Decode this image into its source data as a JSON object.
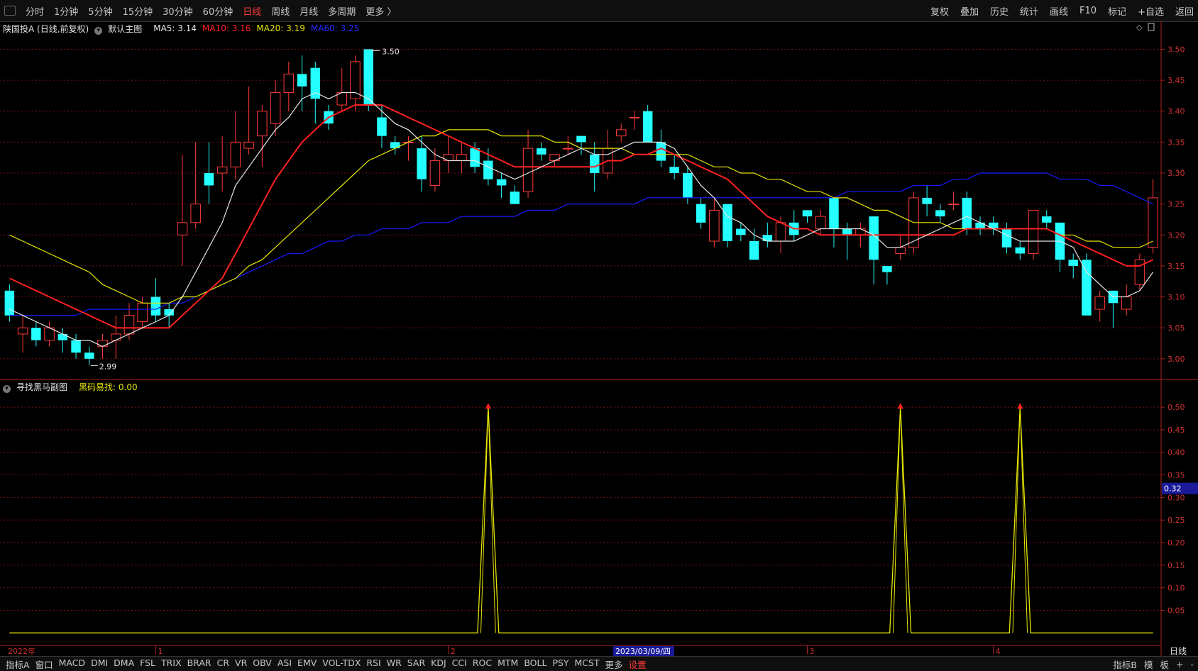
{
  "topbar": {
    "periods": [
      "分时",
      "1分钟",
      "5分钟",
      "15分钟",
      "30分钟",
      "60分钟",
      "日线",
      "周线",
      "月线",
      "多周期",
      "更多 〉"
    ],
    "active_period": "日线",
    "right_buttons": [
      "复权",
      "叠加",
      "历史",
      "统计",
      "画线",
      "F10",
      "标记",
      "+自选",
      "返回"
    ]
  },
  "main_legend": {
    "stock": "陕国投A (日线,前复权)",
    "template": "默认主图",
    "ma5": "MA5: 3.14",
    "ma10": "MA10: 3.16",
    "ma20": "MA20: 3.19",
    "ma60": "MA60: 3.25"
  },
  "sub_legend": {
    "name": "寻找黑马副图",
    "indicator": "黑码易找: 0.00"
  },
  "colors": {
    "up": "#ff3a3a",
    "down": "#24ffff",
    "ma5": "#e6e6e6",
    "ma10": "#ff2020",
    "ma20": "#e6e600",
    "ma60": "#1a1aff",
    "grid": "#7a1010",
    "axis": "#b02020"
  },
  "bottombar": {
    "items": [
      "指标A",
      "窗口",
      "MACD",
      "DMI",
      "DMA",
      "FSL",
      "TRIX",
      "BRAR",
      "CR",
      "VR",
      "OBV",
      "ASI",
      "EMV",
      "VOL-TDX",
      "RSI",
      "WR",
      "SAR",
      "KDJ",
      "CCI",
      "ROC",
      "MTM",
      "BOLL",
      "PSY",
      "MCST",
      "更多",
      "设置"
    ],
    "right_items": [
      "指标B",
      "模",
      "板",
      "+",
      "-"
    ]
  },
  "chart_data": [
    {
      "type": "candlestick",
      "title": "",
      "ylim": [
        2.97,
        3.52
      ],
      "yticks": [
        "3.50",
        "3.45",
        "3.40",
        "3.35",
        "3.30",
        "3.25",
        "3.20",
        "3.15",
        "3.10",
        "3.05",
        "3.00"
      ],
      "annotations": {
        "high": "3.50",
        "low": "2.99"
      },
      "x_labels": [
        "2022年",
        "1",
        "2",
        "3",
        "4"
      ],
      "crosshair_date": "2023/03/09/四",
      "period_label": "日线",
      "candles": [
        [
          3.11,
          3.07,
          3.12,
          3.06
        ],
        [
          3.04,
          3.05,
          3.07,
          3.01
        ],
        [
          3.05,
          3.03,
          3.06,
          3.02
        ],
        [
          3.03,
          3.05,
          3.06,
          3.02
        ],
        [
          3.04,
          3.03,
          3.05,
          3.01
        ],
        [
          3.03,
          3.01,
          3.04,
          3.0
        ],
        [
          3.01,
          3.0,
          3.02,
          2.99
        ],
        [
          3.02,
          3.03,
          3.04,
          3.0
        ],
        [
          3.03,
          3.04,
          3.07,
          3.0
        ],
        [
          3.04,
          3.07,
          3.09,
          3.03
        ],
        [
          3.06,
          3.09,
          3.1,
          3.05
        ],
        [
          3.1,
          3.07,
          3.13,
          3.06
        ],
        [
          3.08,
          3.07,
          3.09,
          3.05
        ],
        [
          3.2,
          3.22,
          3.33,
          3.15
        ],
        [
          3.22,
          3.25,
          3.35,
          3.21
        ],
        [
          3.3,
          3.28,
          3.35,
          3.25
        ],
        [
          3.3,
          3.31,
          3.36,
          3.27
        ],
        [
          3.31,
          3.35,
          3.4,
          3.29
        ],
        [
          3.34,
          3.35,
          3.44,
          3.33
        ],
        [
          3.36,
          3.4,
          3.41,
          3.31
        ],
        [
          3.38,
          3.43,
          3.45,
          3.36
        ],
        [
          3.43,
          3.46,
          3.48,
          3.4
        ],
        [
          3.46,
          3.44,
          3.49,
          3.4
        ],
        [
          3.47,
          3.42,
          3.48,
          3.38
        ],
        [
          3.4,
          3.38,
          3.41,
          3.37
        ],
        [
          3.41,
          3.43,
          3.47,
          3.4
        ],
        [
          3.42,
          3.48,
          3.49,
          3.4
        ],
        [
          3.5,
          3.41,
          3.5,
          3.4
        ],
        [
          3.39,
          3.36,
          3.41,
          3.34
        ],
        [
          3.35,
          3.34,
          3.36,
          3.33
        ],
        [
          3.35,
          3.35,
          3.36,
          3.32
        ],
        [
          3.34,
          3.29,
          3.36,
          3.27
        ],
        [
          3.28,
          3.32,
          3.34,
          3.27
        ],
        [
          3.32,
          3.33,
          3.36,
          3.3
        ],
        [
          3.32,
          3.33,
          3.35,
          3.3
        ],
        [
          3.34,
          3.31,
          3.35,
          3.3
        ],
        [
          3.32,
          3.29,
          3.34,
          3.28
        ],
        [
          3.29,
          3.28,
          3.3,
          3.26
        ],
        [
          3.27,
          3.25,
          3.28,
          3.25
        ],
        [
          3.27,
          3.34,
          3.37,
          3.26
        ],
        [
          3.34,
          3.33,
          3.35,
          3.32
        ],
        [
          3.32,
          3.33,
          3.33,
          3.31
        ],
        [
          3.34,
          3.34,
          3.36,
          3.33
        ],
        [
          3.36,
          3.35,
          3.36,
          3.33
        ],
        [
          3.33,
          3.3,
          3.35,
          3.27
        ],
        [
          3.3,
          3.34,
          3.37,
          3.29
        ],
        [
          3.36,
          3.37,
          3.38,
          3.35
        ],
        [
          3.39,
          3.39,
          3.4,
          3.37
        ],
        [
          3.4,
          3.35,
          3.41,
          3.35
        ],
        [
          3.35,
          3.32,
          3.37,
          3.31
        ],
        [
          3.31,
          3.3,
          3.33,
          3.29
        ],
        [
          3.3,
          3.26,
          3.31,
          3.25
        ],
        [
          3.25,
          3.22,
          3.26,
          3.21
        ],
        [
          3.19,
          3.24,
          3.26,
          3.18
        ],
        [
          3.25,
          3.19,
          3.25,
          3.18
        ],
        [
          3.21,
          3.2,
          3.22,
          3.19
        ],
        [
          3.19,
          3.16,
          3.21,
          3.16
        ],
        [
          3.2,
          3.19,
          3.22,
          3.18
        ],
        [
          3.19,
          3.22,
          3.23,
          3.17
        ],
        [
          3.22,
          3.2,
          3.24,
          3.19
        ],
        [
          3.24,
          3.23,
          3.24,
          3.22
        ],
        [
          3.21,
          3.23,
          3.24,
          3.2
        ],
        [
          3.26,
          3.21,
          3.26,
          3.18
        ],
        [
          3.21,
          3.2,
          3.22,
          3.16
        ],
        [
          3.2,
          3.21,
          3.22,
          3.18
        ],
        [
          3.23,
          3.16,
          3.23,
          3.12
        ],
        [
          3.15,
          3.14,
          3.15,
          3.12
        ],
        [
          3.17,
          3.18,
          3.2,
          3.16
        ],
        [
          3.18,
          3.26,
          3.27,
          3.17
        ],
        [
          3.26,
          3.25,
          3.28,
          3.23
        ],
        [
          3.24,
          3.23,
          3.25,
          3.22
        ],
        [
          3.25,
          3.25,
          3.27,
          3.24
        ],
        [
          3.26,
          3.21,
          3.27,
          3.2
        ],
        [
          3.22,
          3.21,
          3.23,
          3.2
        ],
        [
          3.22,
          3.21,
          3.23,
          3.2
        ],
        [
          3.21,
          3.18,
          3.22,
          3.17
        ],
        [
          3.18,
          3.17,
          3.19,
          3.16
        ],
        [
          3.17,
          3.24,
          3.24,
          3.16
        ],
        [
          3.23,
          3.22,
          3.24,
          3.21
        ],
        [
          3.22,
          3.16,
          3.22,
          3.14
        ],
        [
          3.16,
          3.15,
          3.17,
          3.13
        ],
        [
          3.16,
          3.07,
          3.17,
          3.07
        ],
        [
          3.08,
          3.1,
          3.11,
          3.06
        ],
        [
          3.11,
          3.09,
          3.11,
          3.05
        ],
        [
          3.08,
          3.1,
          3.12,
          3.07
        ],
        [
          3.12,
          3.16,
          3.17,
          3.11
        ],
        [
          3.18,
          3.26,
          3.29,
          3.17
        ]
      ],
      "ma5": [
        3.08,
        3.07,
        3.06,
        3.05,
        3.04,
        3.03,
        3.03,
        3.02,
        3.03,
        3.04,
        3.05,
        3.06,
        3.07,
        3.1,
        3.14,
        3.18,
        3.22,
        3.28,
        3.31,
        3.34,
        3.37,
        3.39,
        3.42,
        3.43,
        3.42,
        3.43,
        3.43,
        3.42,
        3.4,
        3.38,
        3.37,
        3.35,
        3.33,
        3.32,
        3.32,
        3.32,
        3.31,
        3.3,
        3.29,
        3.3,
        3.31,
        3.32,
        3.33,
        3.34,
        3.33,
        3.33,
        3.34,
        3.35,
        3.35,
        3.35,
        3.34,
        3.31,
        3.28,
        3.26,
        3.23,
        3.22,
        3.2,
        3.19,
        3.19,
        3.19,
        3.2,
        3.21,
        3.21,
        3.21,
        3.21,
        3.2,
        3.18,
        3.18,
        3.19,
        3.2,
        3.21,
        3.22,
        3.23,
        3.22,
        3.21,
        3.2,
        3.19,
        3.19,
        3.19,
        3.19,
        3.18,
        3.14,
        3.12,
        3.1,
        3.1,
        3.11,
        3.14
      ],
      "ma10": [
        3.13,
        3.12,
        3.11,
        3.1,
        3.09,
        3.08,
        3.07,
        3.06,
        3.05,
        3.05,
        3.05,
        3.05,
        3.05,
        3.07,
        3.09,
        3.11,
        3.13,
        3.17,
        3.21,
        3.25,
        3.29,
        3.32,
        3.35,
        3.37,
        3.39,
        3.4,
        3.41,
        3.41,
        3.41,
        3.4,
        3.39,
        3.38,
        3.37,
        3.36,
        3.35,
        3.34,
        3.33,
        3.32,
        3.31,
        3.31,
        3.31,
        3.31,
        3.31,
        3.31,
        3.31,
        3.32,
        3.32,
        3.33,
        3.33,
        3.34,
        3.33,
        3.32,
        3.31,
        3.3,
        3.29,
        3.27,
        3.25,
        3.23,
        3.22,
        3.21,
        3.21,
        3.2,
        3.2,
        3.2,
        3.2,
        3.2,
        3.2,
        3.2,
        3.2,
        3.2,
        3.2,
        3.2,
        3.21,
        3.21,
        3.21,
        3.21,
        3.21,
        3.21,
        3.21,
        3.2,
        3.19,
        3.18,
        3.17,
        3.16,
        3.15,
        3.15,
        3.16
      ],
      "ma20": [
        3.2,
        3.19,
        3.18,
        3.17,
        3.16,
        3.15,
        3.14,
        3.12,
        3.11,
        3.1,
        3.09,
        3.09,
        3.09,
        3.1,
        3.1,
        3.11,
        3.12,
        3.13,
        3.15,
        3.16,
        3.18,
        3.2,
        3.22,
        3.24,
        3.26,
        3.28,
        3.3,
        3.32,
        3.33,
        3.34,
        3.35,
        3.36,
        3.36,
        3.37,
        3.37,
        3.37,
        3.37,
        3.36,
        3.36,
        3.36,
        3.36,
        3.35,
        3.35,
        3.34,
        3.34,
        3.34,
        3.34,
        3.33,
        3.33,
        3.33,
        3.33,
        3.33,
        3.32,
        3.31,
        3.31,
        3.3,
        3.3,
        3.29,
        3.29,
        3.28,
        3.27,
        3.27,
        3.26,
        3.26,
        3.25,
        3.24,
        3.24,
        3.23,
        3.22,
        3.22,
        3.22,
        3.21,
        3.21,
        3.21,
        3.21,
        3.21,
        3.21,
        3.21,
        3.21,
        3.2,
        3.2,
        3.19,
        3.19,
        3.18,
        3.18,
        3.18,
        3.19
      ],
      "ma60": [
        3.07,
        3.07,
        3.07,
        3.07,
        3.07,
        3.07,
        3.08,
        3.08,
        3.08,
        3.08,
        3.08,
        3.08,
        3.09,
        3.09,
        3.1,
        3.11,
        3.12,
        3.13,
        3.14,
        3.15,
        3.16,
        3.17,
        3.17,
        3.18,
        3.19,
        3.19,
        3.2,
        3.2,
        3.21,
        3.21,
        3.21,
        3.22,
        3.22,
        3.22,
        3.23,
        3.23,
        3.23,
        3.23,
        3.23,
        3.24,
        3.24,
        3.24,
        3.25,
        3.25,
        3.25,
        3.25,
        3.25,
        3.25,
        3.26,
        3.26,
        3.26,
        3.26,
        3.26,
        3.26,
        3.26,
        3.26,
        3.26,
        3.26,
        3.26,
        3.26,
        3.26,
        3.26,
        3.26,
        3.27,
        3.27,
        3.27,
        3.27,
        3.27,
        3.28,
        3.28,
        3.28,
        3.29,
        3.29,
        3.3,
        3.3,
        3.3,
        3.3,
        3.3,
        3.3,
        3.29,
        3.29,
        3.29,
        3.28,
        3.28,
        3.27,
        3.26,
        3.25
      ]
    },
    {
      "type": "line",
      "title": "",
      "ylim": [
        -0.02,
        0.53
      ],
      "yticks": [
        "0.50",
        "0.45",
        "0.40",
        "0.35",
        "0.30",
        "0.25",
        "0.20",
        "0.15",
        "0.10",
        "0.05"
      ],
      "cursor_value": "0.32",
      "series": [
        {
          "values": [
            0,
            0,
            0,
            0,
            0,
            0,
            0,
            0,
            0,
            0,
            0,
            0,
            0,
            0,
            0,
            0,
            0,
            0,
            0,
            0,
            0,
            0,
            0,
            0,
            0,
            0,
            0,
            0,
            0,
            0,
            0,
            0,
            0,
            0,
            0,
            0,
            0.5,
            0,
            0,
            0,
            0,
            0,
            0,
            0,
            0,
            0,
            0,
            0,
            0,
            0,
            0,
            0,
            0,
            0,
            0,
            0,
            0,
            0,
            0,
            0,
            0,
            0,
            0,
            0,
            0,
            0,
            0,
            0.5,
            0,
            0,
            0,
            0,
            0,
            0,
            0,
            0,
            0.5,
            0,
            0,
            0,
            0,
            0,
            0,
            0,
            0,
            0,
            0
          ]
        }
      ]
    }
  ]
}
